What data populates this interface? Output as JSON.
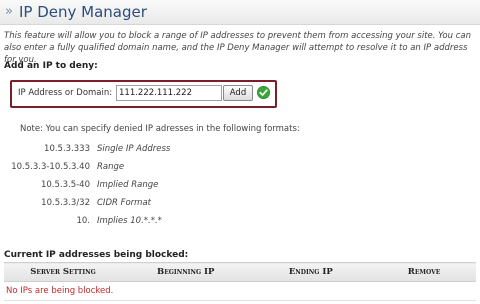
{
  "header": {
    "title": "IP Deny Manager"
  },
  "intro": "This feature will allow you to block a range of IP addresses to prevent them from accessing your site. You can also enter a fully qualified domain name, and the IP Deny Manager will attempt to resolve it to an IP address for you.",
  "add_section": {
    "label": "Add an IP to deny:",
    "field_label": "IP Address or Domain:",
    "field_value": "111.222.111.222",
    "button_label": "Add"
  },
  "note": "Note: You can specify denied IP adresses in the following formats:",
  "formats": [
    {
      "example": "10.5.3.333",
      "description": "Single IP Address"
    },
    {
      "example": "10.5.3.3-10.5.3.40",
      "description": "Range"
    },
    {
      "example": "10.5.3.5-40",
      "description": "Implied Range"
    },
    {
      "example": "10.5.3.3/32",
      "description": "CIDR Format"
    },
    {
      "example": "10.",
      "description": "Implies 10.*.*.*"
    }
  ],
  "blocked": {
    "label": "Current IP addresses being blocked:",
    "columns": [
      "Server Setting",
      "Beginning IP",
      "Ending IP",
      "Remove"
    ],
    "empty_message": "No IPs are being blocked."
  },
  "colors": {
    "accent_border": "#7a1f2b",
    "empty_text": "#c0292b",
    "title": "#2d4d7c"
  }
}
